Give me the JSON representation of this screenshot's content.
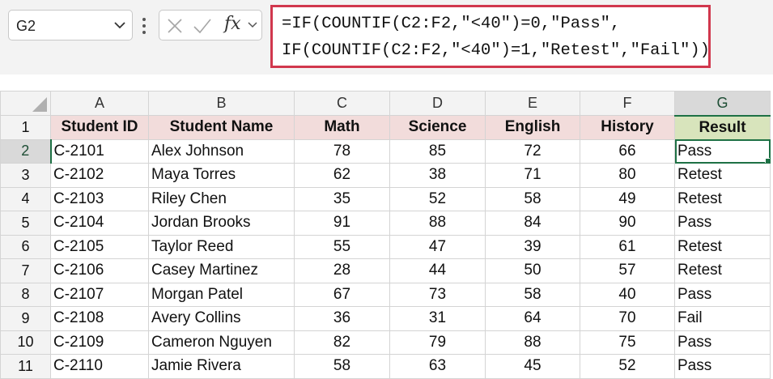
{
  "name_box": {
    "value": "G2"
  },
  "formula_bar": {
    "fx_label": "fx",
    "line1": "=IF(COUNTIF(C2:F2,\"<40\")=0,\"Pass\",",
    "line2": "IF(COUNTIF(C2:F2,\"<40\")=1,\"Retest\",\"Fail\"))"
  },
  "columns": [
    "A",
    "B",
    "C",
    "D",
    "E",
    "F",
    "G"
  ],
  "headers": [
    "Student ID",
    "Student Name",
    "Math",
    "Science",
    "English",
    "History",
    "Result"
  ],
  "rows": [
    {
      "num": "2",
      "cells": [
        "C-2101",
        "Alex Johnson",
        "78",
        "85",
        "72",
        "66",
        "Pass"
      ]
    },
    {
      "num": "3",
      "cells": [
        "C-2102",
        "Maya Torres",
        "62",
        "38",
        "71",
        "80",
        "Retest"
      ]
    },
    {
      "num": "4",
      "cells": [
        "C-2103",
        "Riley Chen",
        "35",
        "52",
        "58",
        "49",
        "Retest"
      ]
    },
    {
      "num": "5",
      "cells": [
        "C-2104",
        "Jordan Brooks",
        "91",
        "88",
        "84",
        "90",
        "Pass"
      ]
    },
    {
      "num": "6",
      "cells": [
        "C-2105",
        "Taylor Reed",
        "55",
        "47",
        "39",
        "61",
        "Retest"
      ]
    },
    {
      "num": "7",
      "cells": [
        "C-2106",
        "Casey Martinez",
        "28",
        "44",
        "50",
        "57",
        "Retest"
      ]
    },
    {
      "num": "8",
      "cells": [
        "C-2107",
        "Morgan Patel",
        "67",
        "73",
        "58",
        "40",
        "Pass"
      ]
    },
    {
      "num": "9",
      "cells": [
        "C-2108",
        "Avery Collins",
        "36",
        "31",
        "64",
        "70",
        "Fail"
      ]
    },
    {
      "num": "10",
      "cells": [
        "C-2109",
        "Cameron Nguyen",
        "82",
        "79",
        "88",
        "75",
        "Pass"
      ]
    },
    {
      "num": "11",
      "cells": [
        "C-2110",
        "Jamie Rivera",
        "58",
        "63",
        "45",
        "52",
        "Pass"
      ]
    }
  ],
  "header_row_num": "1",
  "colors": {
    "header_fill": "#f2dcdb",
    "result_header_fill": "#d8e4bc",
    "selection": "#1e7145",
    "formula_highlight": "#d1374d"
  }
}
